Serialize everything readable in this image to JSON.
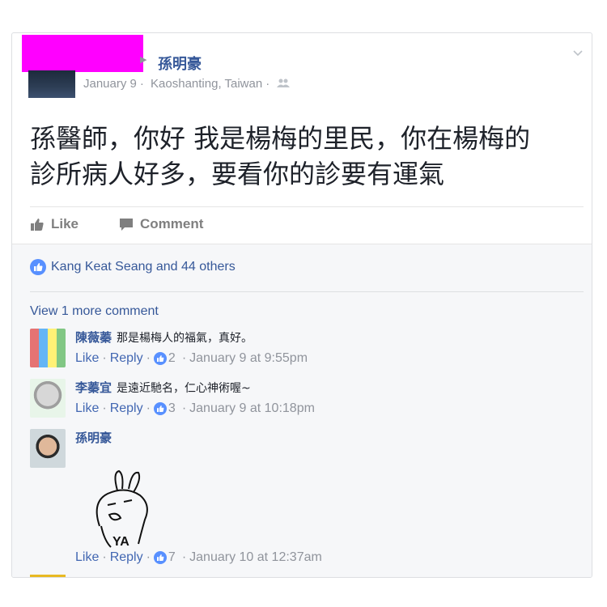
{
  "post": {
    "author": "孫明豪",
    "date": "January 9",
    "location": "Kaoshanting, Taiwan",
    "audience_icon": "friends-icon",
    "text_line1": "孫醫師，你好 我是楊梅的里民，你在楊梅的",
    "text_line2": "診所病人好多，要看你的診要有運氣"
  },
  "actions": {
    "like_label": "Like",
    "comment_label": "Comment"
  },
  "likes_summary": "Kang Keat Seang and 44 others",
  "view_more": "View 1 more comment",
  "comments": [
    {
      "author": "陳薇蓁",
      "text": "那是楊梅人的福氣，真好。",
      "like_label": "Like",
      "reply_label": "Reply",
      "reactions": "2",
      "timestamp": "January 9 at 9:55pm"
    },
    {
      "author": "李蓁宜",
      "text": "是遠近馳名，仁心神術喔~",
      "like_label": "Like",
      "reply_label": "Reply",
      "reactions": "3",
      "timestamp": "January 9 at 10:18pm"
    },
    {
      "author": "孫明豪",
      "text": "",
      "like_label": "Like",
      "reply_label": "Reply",
      "reactions": "7",
      "timestamp": "January 10 at 12:37am",
      "sticker_text": "YA"
    }
  ],
  "colors": {
    "link": "#365899",
    "muted": "#90949c",
    "redaction": "#ff00ff",
    "like_blue": "#4267b2"
  }
}
